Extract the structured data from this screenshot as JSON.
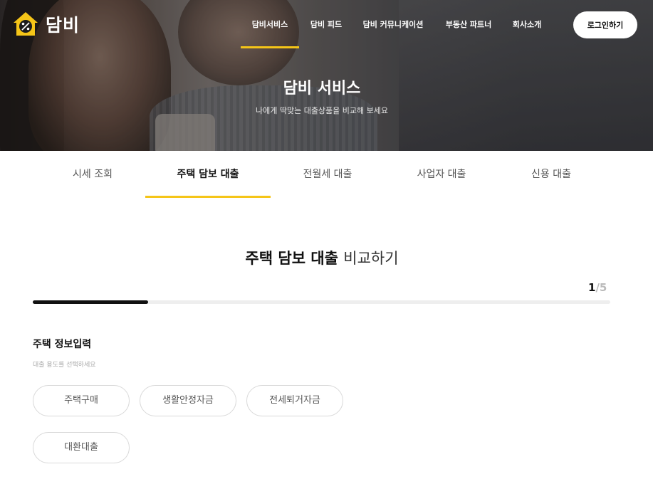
{
  "brand": {
    "name": "담비",
    "accent": "#f5c518"
  },
  "nav": {
    "items": [
      {
        "label": "담비서비스",
        "active": true
      },
      {
        "label": "담비 피드"
      },
      {
        "label": "담비 커뮤니케이션"
      },
      {
        "label": "부동산 파트너"
      },
      {
        "label": "회사소개"
      }
    ],
    "login_label": "로그인하기"
  },
  "hero": {
    "title": "담비 서비스",
    "subtitle": "나에게 딱맞는 대출상품을 비교해 보세요"
  },
  "tabs": [
    {
      "label": "시세 조회"
    },
    {
      "label": "주택 담보 대출",
      "active": true
    },
    {
      "label": "전월세 대출"
    },
    {
      "label": "사업자 대출"
    },
    {
      "label": "신용 대출"
    }
  ],
  "main": {
    "title_bold": "주택 담보 대출",
    "title_light": "비교하기",
    "step_current": "1",
    "step_sep": "/",
    "step_total": "5",
    "progress_fraction": 0.2,
    "form_title": "주택 정보입력",
    "form_desc": "대출 용도를 선택하세요",
    "options": [
      "주택구매",
      "생활안정자금",
      "전세퇴거자금",
      "대환대출"
    ]
  }
}
